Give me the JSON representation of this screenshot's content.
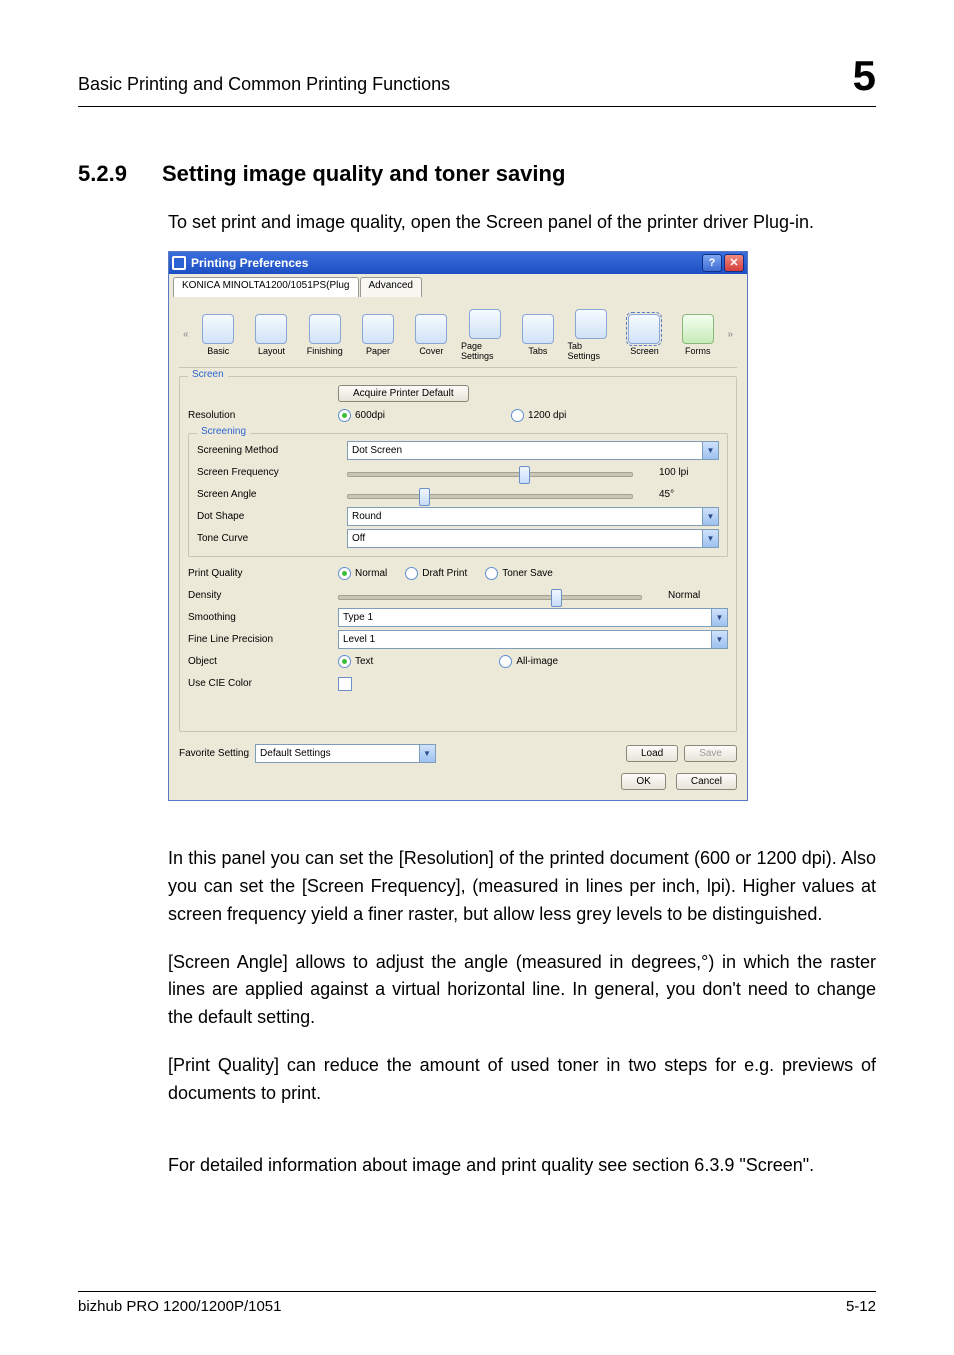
{
  "page": {
    "header_title": "Basic Printing and Common Printing Functions",
    "chapter": "5",
    "section_no": "5.2.9",
    "section_title": "Setting image quality and toner saving",
    "intro": "To set print and image quality, open the Screen panel of the printer driver Plug-in.",
    "para1": "In this panel you can set the [Resolution] of the printed document (600 or 1200 dpi). Also you can set the [Screen Frequency], (measured in lines per inch, lpi). Higher values at screen frequency yield a finer raster, but allow less grey levels to be distinguished.",
    "para2": "[Screen Angle] allows to adjust the angle (measured in degrees,°) in which the raster lines are applied against a virtual horizontal line. In general, you don't need to change the default setting.",
    "para3": "[Print Quality] can reduce the amount of used toner in two steps for e.g. previews of documents to print.",
    "para4": "For detailed information about image and print quality see section 6.3.9 \"Screen\".",
    "footer_left": "bizhub PRO 1200/1200P/1051",
    "footer_right": "5-12"
  },
  "dlg": {
    "title": "Printing Preferences",
    "tab_active": "KONICA MINOLTA1200/1051PS(Plug",
    "tab_other": "Advanced",
    "tools": [
      "Basic",
      "Layout",
      "Finishing",
      "Paper",
      "Cover",
      "Page Settings",
      "Tabs",
      "Tab Settings",
      "Screen",
      "Forms"
    ],
    "btn_acquire": "Acquire Printer Default",
    "group_screen": "Screen",
    "group_screening": "Screening",
    "labels": {
      "resolution": "Resolution",
      "r600": "600dpi",
      "r1200": "1200 dpi",
      "method": "Screening Method",
      "method_v": "Dot Screen",
      "freq": "Screen Frequency",
      "freq_v": "100 lpi",
      "angle": "Screen Angle",
      "angle_v": "45°",
      "dot": "Dot Shape",
      "dot_v": "Round",
      "tone": "Tone Curve",
      "tone_v": "Off",
      "pq": "Print Quality",
      "pq_normal": "Normal",
      "pq_draft": "Draft Print",
      "pq_toner": "Toner Save",
      "density": "Density",
      "density_v": "Normal",
      "smoothing": "Smoothing",
      "smoothing_v": "Type 1",
      "fine": "Fine Line Precision",
      "fine_v": "Level 1",
      "object": "Object",
      "obj_text": "Text",
      "obj_all": "All-image",
      "cie": "Use CIE Color"
    },
    "fav_label": "Favorite Setting",
    "fav_value": "Default Settings",
    "btn_load": "Load",
    "btn_save": "Save",
    "btn_ok": "OK",
    "btn_cancel": "Cancel"
  }
}
